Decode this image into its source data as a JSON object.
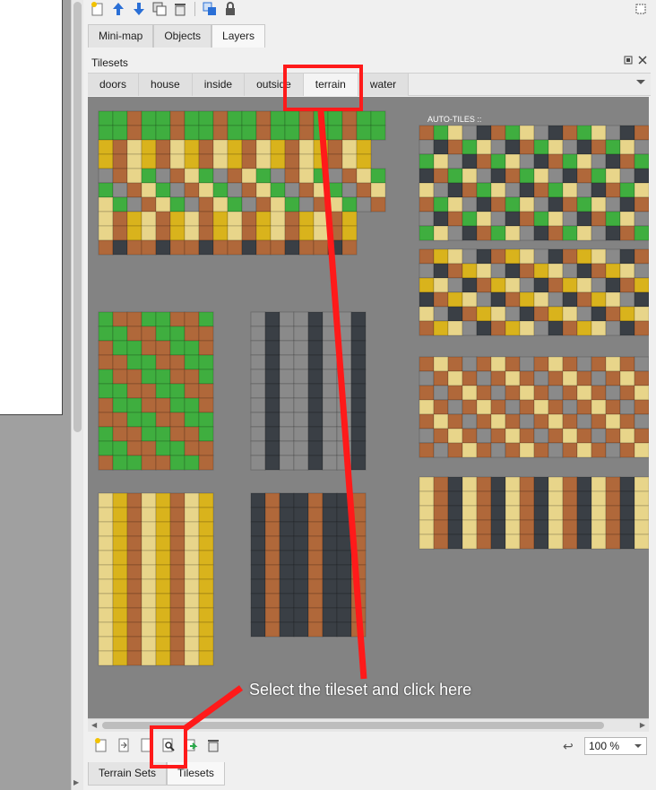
{
  "dock_tabs": [
    "Mini-map",
    "Objects",
    "Layers"
  ],
  "panel": {
    "title": "Tilesets"
  },
  "tileset_tabs": [
    "doors",
    "house",
    "inside",
    "outside",
    "terrain",
    "water"
  ],
  "active_tileset": "terrain",
  "autotiles_label": "AUTO-TILES ::",
  "zoom": "100 %",
  "bottom_tabs": [
    "Terrain Sets",
    "Tilesets"
  ],
  "annotation": {
    "text": "Select the tileset and click here",
    "color": "#ff1a1a"
  },
  "colors": {
    "grass": "#3fae3f",
    "dirt": "#b0683a",
    "sand": "#e8d58a",
    "stone": "#8a8a8a",
    "dark": "#3a3f45",
    "gold": "#d9b31c",
    "bg": "#838383"
  }
}
